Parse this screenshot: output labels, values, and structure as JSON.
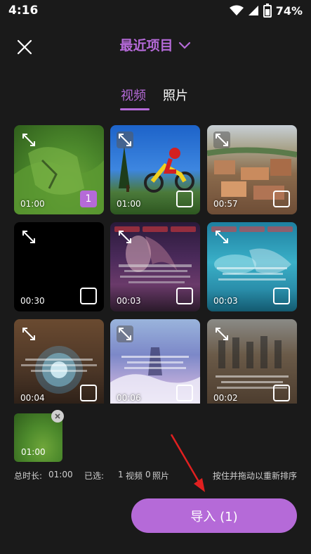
{
  "status": {
    "time": "4:16",
    "battery": "74%"
  },
  "header": {
    "title": "最近项目"
  },
  "tabs": {
    "video": "视频",
    "photo": "照片"
  },
  "media": [
    {
      "duration": "01:00",
      "selected_index": "1"
    },
    {
      "duration": "01:00"
    },
    {
      "duration": "00:57"
    },
    {
      "duration": "00:30"
    },
    {
      "duration": "00:03"
    },
    {
      "duration": "00:03"
    },
    {
      "duration": "00:04"
    },
    {
      "duration": "00:06"
    },
    {
      "duration": "00:02"
    }
  ],
  "selection": {
    "duration": "01:00"
  },
  "summary": {
    "total_label": "总时长:",
    "total_value": "01:00",
    "selected_label": "已选:",
    "video_count": "1",
    "video_label": "视频",
    "photo_count": "0",
    "photo_label": "照片",
    "hint": "按住并拖动以重新排序"
  },
  "import_button": {
    "label": "导入 (1)"
  },
  "colors": {
    "accent": "#b56ad8",
    "background": "#1a1a1a"
  }
}
